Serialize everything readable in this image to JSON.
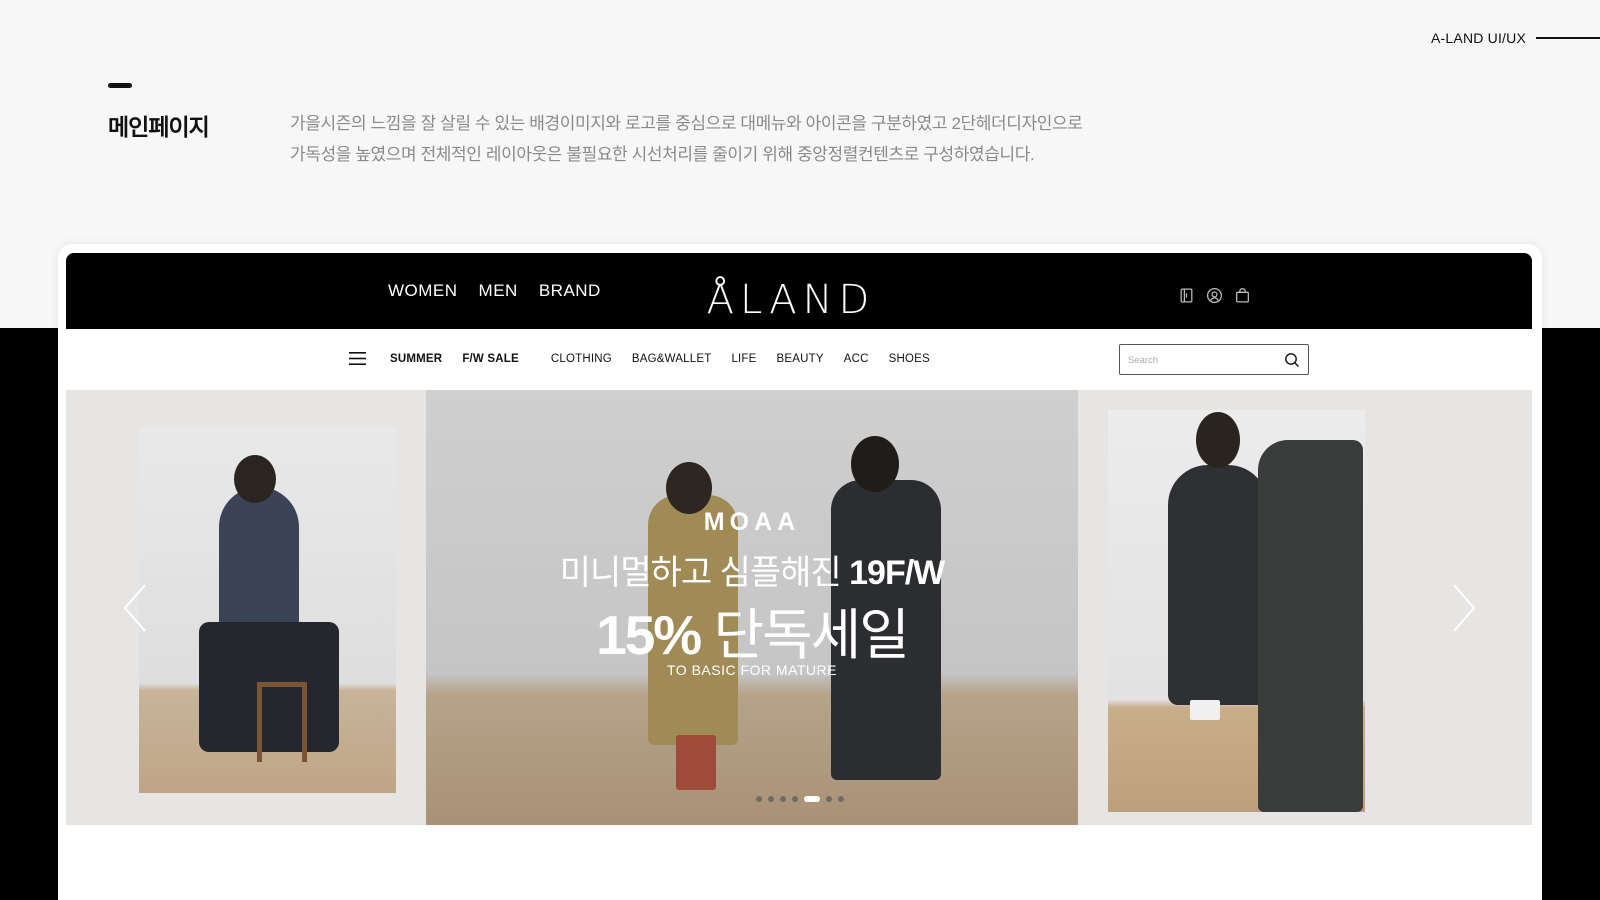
{
  "corner_tag": "A-LAND UI/UX",
  "section": {
    "title": "메인페이지",
    "description_line1": "가을시즌의 느낌을 잘 살릴 수 있는 배경이미지와 로고를 중심으로 대메뉴와 아이콘을 구분하였고 2단헤더디자인으로",
    "description_line2": "가독성을 높였으며 전체적인 레이아웃은 불필요한 시선처리를 줄이기 위해 중앙정렬컨텐츠로 구성하였습니다."
  },
  "site": {
    "logo": "ÅLAND",
    "top_nav": [
      "WOMEN",
      "MEN",
      "BRAND"
    ],
    "top_icons": [
      "book-icon",
      "user-icon",
      "shopping-bag-icon"
    ],
    "sub_nav": {
      "highlight": [
        "SUMMER",
        "F/W SALE"
      ],
      "categories": [
        "CLOTHING",
        "BAG&WALLET",
        "LIFE",
        "BEAUTY",
        "ACC",
        "SHOES"
      ]
    },
    "search": {
      "placeholder": "Search"
    }
  },
  "hero": {
    "brand": "MOAA",
    "headline1_regular": "미니멀하고 심플해진 ",
    "headline1_bold": "19F/W",
    "headline2_bold": "15%",
    "headline2_regular": " 단독세일",
    "subline": "TO BASIC FOR MATURE",
    "slide_count": 7,
    "active_slide": 5
  },
  "colors": {
    "background": "#f7f7f7",
    "header": "#000000",
    "description_text": "#8a8a8a",
    "accent": "#111111"
  }
}
